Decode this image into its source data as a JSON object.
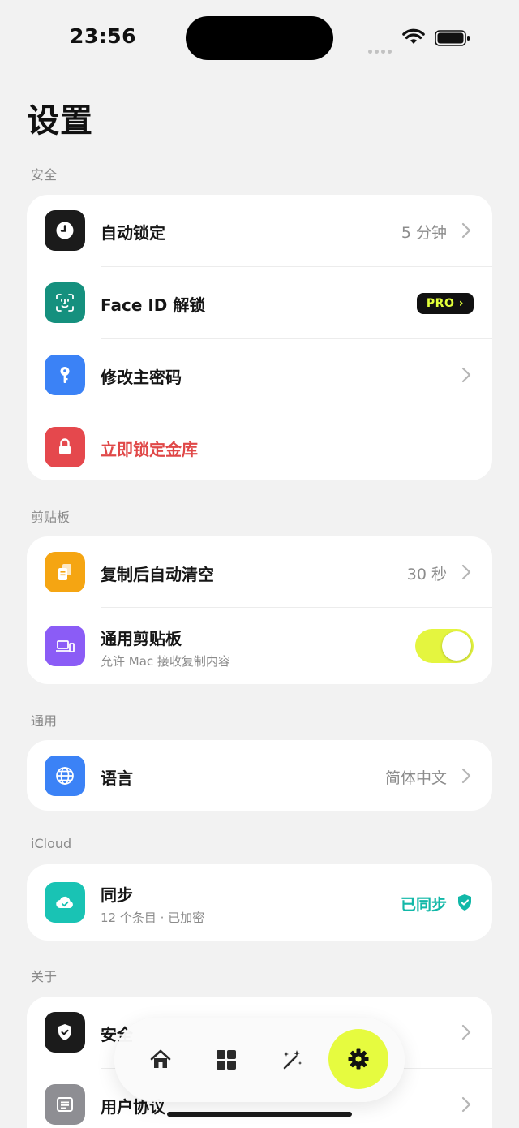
{
  "status": {
    "time": "23:56"
  },
  "page": {
    "title": "设置"
  },
  "sections": {
    "security": {
      "label": "安全",
      "auto_lock": {
        "title": "自动锁定",
        "value": "5 分钟"
      },
      "face_id": {
        "title": "Face ID 解锁",
        "badge": "PRO ›"
      },
      "master_password": {
        "title": "修改主密码"
      },
      "lock_now": {
        "title": "立即锁定金库"
      }
    },
    "clipboard": {
      "label": "剪贴板",
      "auto_clear": {
        "title": "复制后自动清空",
        "value": "30 秒"
      },
      "universal": {
        "title": "通用剪贴板",
        "subtitle": "允许 Mac 接收复制内容",
        "enabled": true
      }
    },
    "general": {
      "label": "通用",
      "language": {
        "title": "语言",
        "value": "简体中文"
      }
    },
    "icloud": {
      "label": "iCloud",
      "sync": {
        "title": "同步",
        "subtitle": "12 个条目 · 已加密",
        "status": "已同步"
      }
    },
    "about": {
      "label": "关于",
      "security_item": {
        "title": "安全"
      },
      "user_agreement": {
        "title": "用户协议"
      }
    }
  },
  "tabbar": {
    "tabs": [
      {
        "icon": "home-icon",
        "active": false
      },
      {
        "icon": "grid-icon",
        "active": false
      },
      {
        "icon": "magic-wand-icon",
        "active": false
      },
      {
        "icon": "gear-icon",
        "active": true
      }
    ]
  },
  "colors": {
    "accent": "#e6fb3f",
    "danger": "#e04848",
    "success": "#12b8a8",
    "icon_clock": "#1b1b1b",
    "icon_face": "#15907e",
    "icon_key": "#3b82f6",
    "icon_lock": "#e5484d",
    "icon_copy": "#f5a512",
    "icon_devices": "#8b5cf6",
    "icon_globe": "#3b82f6",
    "icon_cloud": "#19c3b4",
    "icon_shield": "#1b1b1b",
    "icon_doc": "#8e8e93"
  }
}
